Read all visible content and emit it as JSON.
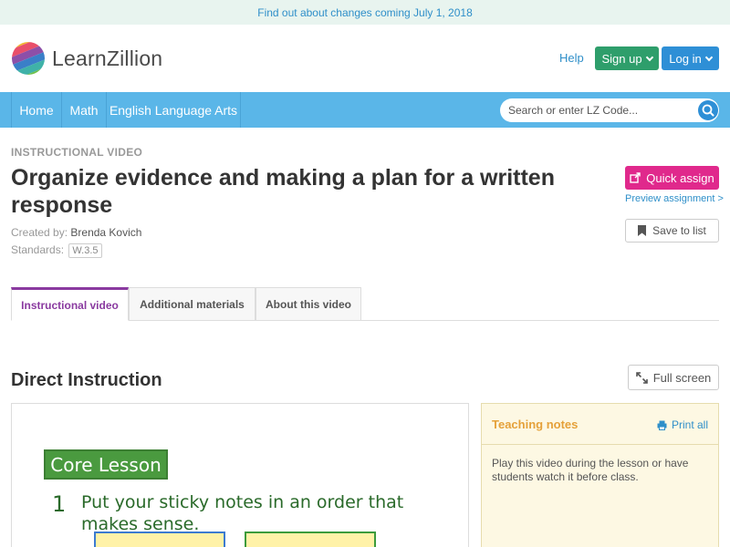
{
  "banner": {
    "text": "Find out about changes coming July 1, 2018"
  },
  "header": {
    "logo_text": "LearnZillion",
    "help": "Help",
    "signup": "Sign up",
    "login": "Log in"
  },
  "nav": {
    "items": [
      {
        "label": "Home"
      },
      {
        "label": "Math"
      },
      {
        "label": "English Language Arts"
      }
    ],
    "search_placeholder": "Search or enter LZ Code..."
  },
  "lesson": {
    "eyebrow": "INSTRUCTIONAL VIDEO",
    "title": "Organize evidence and making a plan for a written response",
    "created_by_label": "Created by:",
    "author": "Brenda Kovich",
    "standards_label": "Standards:",
    "standard": "W.3.5"
  },
  "actions": {
    "quick_assign": "Quick assign",
    "preview": "Preview assignment >",
    "save": "Save to list"
  },
  "tabs": [
    {
      "label": "Instructional video",
      "active": true
    },
    {
      "label": "Additional materials",
      "active": false
    },
    {
      "label": "About this video",
      "active": false
    }
  ],
  "section": {
    "title": "Direct Instruction",
    "fullscreen": "Full screen"
  },
  "video": {
    "badge": "Core Lesson",
    "number": "1",
    "text": "Put your sticky notes in an order that makes sense."
  },
  "notes": {
    "title": "Teaching notes",
    "print": "Print all",
    "body": "Play this video during the lesson or have students watch it before class."
  },
  "colors": {
    "nav": "#5ab6e8",
    "signup": "#2e9e6b",
    "login": "#2e8fd6",
    "quick_assign": "#e0298c",
    "active_tab": "#8a3aa0",
    "notes_title": "#e5a13a"
  }
}
